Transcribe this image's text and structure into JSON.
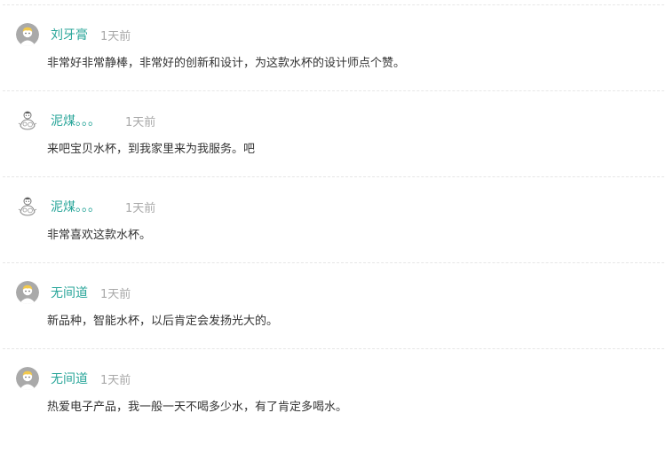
{
  "comments": [
    {
      "username": "刘牙膏",
      "time": "1天前",
      "content": "非常好非常静棒，非常好的创新和设计，为这款水杯的设计师点个赞。",
      "avatar_icon": "default-user-avatar-icon"
    },
    {
      "username": "泥煤。。。",
      "time": "1天前",
      "content": "来吧宝贝水杯，到我家里来为我服务。吧",
      "avatar_icon": "sketch-character-avatar-icon"
    },
    {
      "username": "泥煤。。。",
      "time": "1天前",
      "content": "非常喜欢这款水杯。",
      "avatar_icon": "sketch-character-avatar-icon"
    },
    {
      "username": "无间道",
      "time": "1天前",
      "content": "新品种，智能水杯，以后肯定会发扬光大的。",
      "avatar_icon": "default-user-avatar-icon"
    },
    {
      "username": "无间道",
      "time": "1天前",
      "content": "热爱电子产品，我一般一天不喝多少水，有了肯定多喝水。",
      "avatar_icon": "default-user-avatar-icon"
    }
  ],
  "colors": {
    "username": "#2aa69a",
    "time": "#a8a8a8",
    "content": "#333333",
    "divider": "#e6e6e6"
  }
}
